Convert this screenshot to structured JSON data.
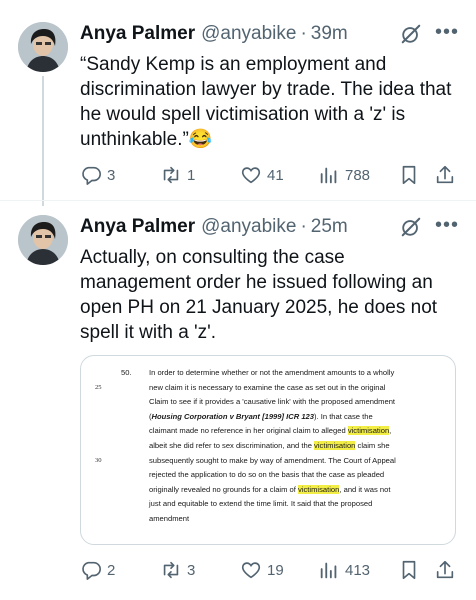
{
  "tweets": [
    {
      "author": "Anya Palmer",
      "handle": "@anyabike",
      "time": "39m",
      "text": "“Sandy Kemp is an employment and discrimination lawyer by trade. The idea that he would spell victimisation with a 'z' is unthinkable.”😂",
      "replies": "3",
      "reposts": "1",
      "likes": "41",
      "views": "788"
    },
    {
      "author": "Anya Palmer",
      "handle": "@anyabike",
      "time": "25m",
      "text": "Actually, on consulting the case management order he issued following an open PH on 21 January 2025, he does not spell it with a 'z'.",
      "replies": "2",
      "reposts": "3",
      "likes": "19",
      "views": "413",
      "document": {
        "paragraph_number": "50.",
        "line_numbers": [
          "25",
          "30"
        ],
        "lines": [
          "In order to determine whether or not the amendment amounts to a wholly",
          "new claim it is necessary to examine the case as set out in the original",
          "Claim to see if it provides a 'causative link' with the proposed amendment",
          "(Housing Corporation v Bryant [1999] ICR 123). In that case the",
          "claimant made no reference in her original claim to alleged victimisation,",
          "albeit she did refer to sex discrimination, and the victimisation claim she",
          "subsequently sought to make by way of amendment. The Court of Appeal",
          "rejected the application to do so on the basis that the case as pleaded",
          "originally revealed no grounds for a claim of victimisation, and it was not",
          "just and equitable to extend the time limit. It said that the proposed",
          "amendment"
        ],
        "highlight_word": "victimisation",
        "highlight_color": "#f3ee46"
      }
    }
  ],
  "ui": {
    "separator": "·",
    "more_label": "•••",
    "icon_color": "#536471"
  }
}
